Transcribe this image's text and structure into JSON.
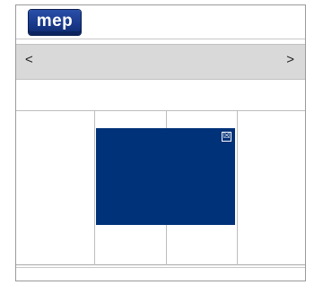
{
  "brand": {
    "logo_text": "mep"
  },
  "nav": {
    "prev_label": "<",
    "next_label": ">"
  },
  "popup": {
    "close_label": "☒",
    "background_color": "#003279"
  }
}
